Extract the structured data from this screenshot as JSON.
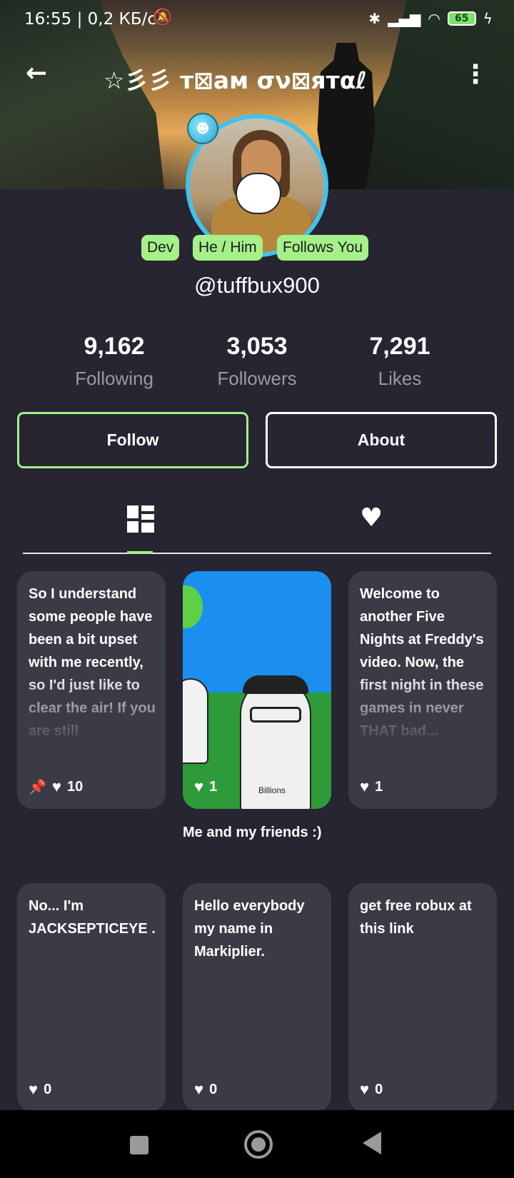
{
  "status": {
    "time": "16:55 | 0,2 КБ/с",
    "battery": "65"
  },
  "header": {
    "title": "☆彡彡 т⊠ам σν⊠ятαℓ"
  },
  "profile": {
    "tags": [
      "Dev",
      "He / Him",
      "Follows You"
    ],
    "handle": "@tuffbux900",
    "stats": [
      {
        "value": "9,162",
        "label": "Following"
      },
      {
        "value": "3,053",
        "label": "Followers"
      },
      {
        "value": "7,291",
        "label": "Likes"
      }
    ],
    "follow_label": "Follow",
    "about_label": "About"
  },
  "tabs": [
    {
      "icon": "posts-grid-icon"
    },
    {
      "icon": "heart-icon"
    }
  ],
  "posts": [
    {
      "text": "So I understand some people have been a bit upset with me recently, so I'd just like to clear the air! If you are still",
      "likes": "10",
      "pinned": true
    },
    {
      "caption": "Me and my friends :)",
      "likes": "1",
      "image_text": "Billions"
    },
    {
      "text": "Welcome to another Five Nights at Freddy's video. Now, the first night in these games in never THAT bad...",
      "likes": "1"
    },
    {
      "text": "No... I'm JACKSEPTICEYE .",
      "likes": "0"
    },
    {
      "text": "Hello everybody my name in Markiplier.",
      "likes": "0"
    },
    {
      "text": "get free robux at this link",
      "likes": "0"
    }
  ],
  "colors": {
    "background": "#262531",
    "card": "#3b3b45",
    "accent": "#a6f08a",
    "avatar_ring": "#3ec3ef"
  }
}
